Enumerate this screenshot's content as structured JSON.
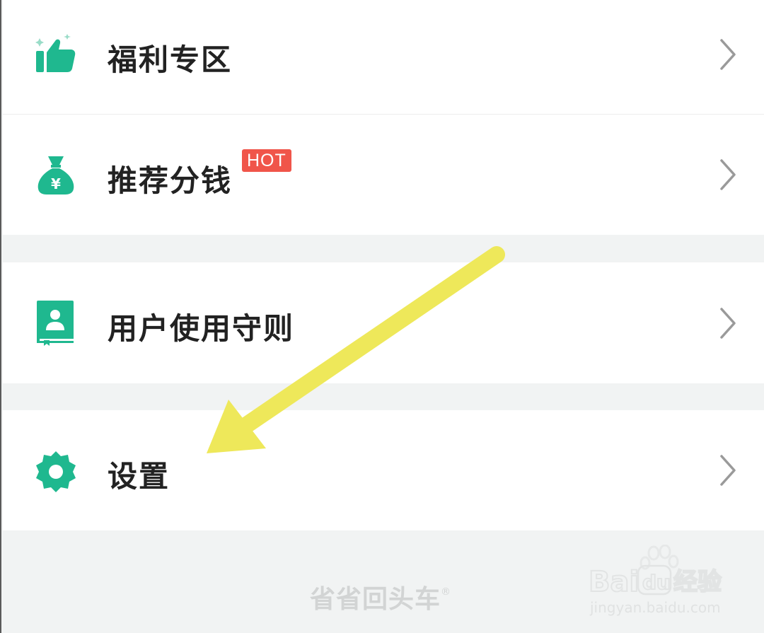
{
  "menu": {
    "items": [
      {
        "label": "福利专区",
        "icon": "thumbs-up-icon"
      },
      {
        "label": "推荐分钱",
        "icon": "money-bag-icon",
        "badge": "HOT"
      },
      {
        "label": "用户使用守则",
        "icon": "user-guide-book-icon"
      },
      {
        "label": "设置",
        "icon": "gear-icon"
      }
    ]
  },
  "footer": {
    "brand": "省省回头车",
    "brand_mark": "®"
  },
  "colors": {
    "accent": "#1fb88f",
    "badge": "#f0554a",
    "arrow": "#eee85a",
    "background": "#f1f3f3"
  }
}
